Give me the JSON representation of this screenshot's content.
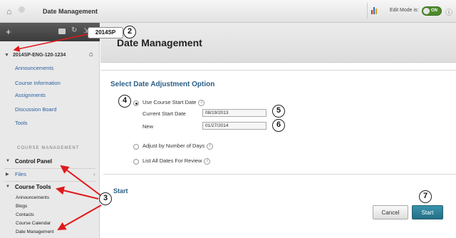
{
  "header": {
    "title": "Date Management",
    "edit_mode_label": "Edit Mode is:",
    "toggle_label": "ON"
  },
  "sidebar": {
    "course_id": "2014SP-ENG-120-1234",
    "nav_items": [
      {
        "label": "Announcements"
      },
      {
        "label": "Course Information"
      },
      {
        "label": "Assignments"
      },
      {
        "label": "Discussion Board"
      },
      {
        "label": "Tools"
      }
    ],
    "course_management_heading": "COURSE MANAGEMENT",
    "control_panel_label": "Control Panel",
    "files_label": "Files",
    "course_tools_label": "Course Tools",
    "course_tools_items": [
      {
        "label": "Announcements"
      },
      {
        "label": "Blogs"
      },
      {
        "label": "Contacts"
      },
      {
        "label": "Course Calendar"
      },
      {
        "label": "Date Management"
      }
    ]
  },
  "main": {
    "page_title": "Date Management",
    "section_title": "Select Date Adjustment Option",
    "options": {
      "use_start_date": "Use Course Start Date",
      "current_start_label": "Current Start Date",
      "current_start_value": "08/19/2013",
      "new_label": "New",
      "new_value": "01/27/2014",
      "adjust_days": "Adjust by Number of Days",
      "list_dates": "List All Dates For Review"
    },
    "help_glyph": "i",
    "start_section_title": "Start",
    "cancel_button": "Cancel",
    "start_button": "Start"
  },
  "annotations": {
    "term_label": "2014SP",
    "callouts": [
      "2",
      "3",
      "4",
      "5",
      "6",
      "7"
    ]
  },
  "colors": {
    "link": "#2a5fa0",
    "section_title": "#2a5f86",
    "start_button": "#2a7f98",
    "toggle_on": "#4c8a2a",
    "arrow": "#e0191b"
  }
}
